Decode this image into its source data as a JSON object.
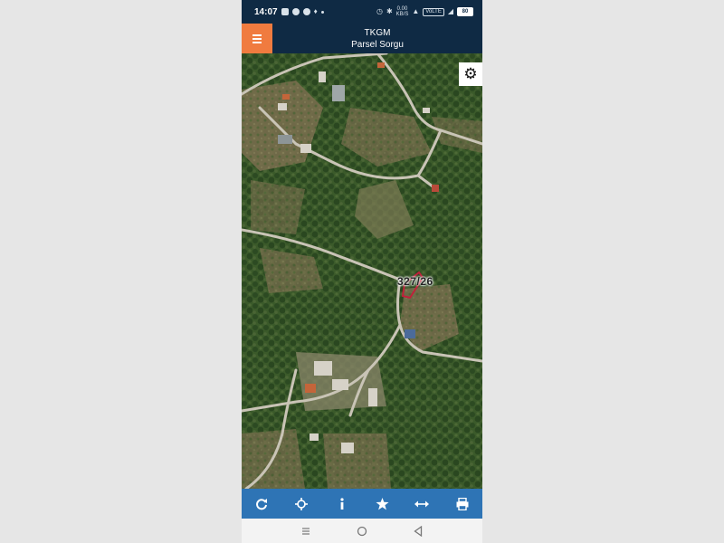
{
  "status_bar": {
    "time": "14:07",
    "battery": "80",
    "network_speed_value": "0.00",
    "network_speed_unit": "KB/S",
    "volte": "VoLTE",
    "left_icons": [
      "message-icon",
      "whatsapp-icon",
      "share-icon",
      "notification-icon",
      "dot-icon"
    ],
    "right_icons": [
      "alarm-icon",
      "bluetooth-icon",
      "wifi-icon",
      "signal-icon",
      "battery-icon"
    ]
  },
  "header": {
    "title": "TKGM",
    "subtitle": "Parsel Sorgu",
    "menu_icon": "hamburger-icon",
    "brand_color": "#0f2a44",
    "menu_color": "#f07b3f"
  },
  "map": {
    "parcel_label": "327/26",
    "parcel_outline_color": "#c0203a",
    "settings_icon": "gear-icon"
  },
  "toolbar": {
    "background": "#2e74b5",
    "buttons": [
      {
        "icon": "refresh-icon"
      },
      {
        "icon": "locate-icon"
      },
      {
        "icon": "info-icon"
      },
      {
        "icon": "star-icon"
      },
      {
        "icon": "measure-icon"
      },
      {
        "icon": "print-icon"
      }
    ]
  },
  "nav_bar": {
    "buttons": [
      "recents-icon",
      "home-icon",
      "back-icon"
    ]
  }
}
